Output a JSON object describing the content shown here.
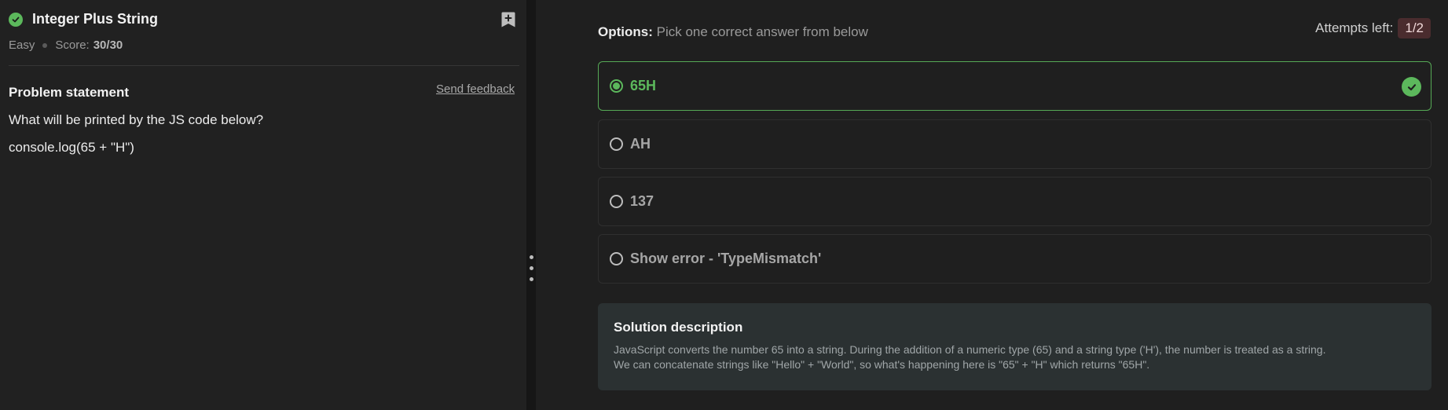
{
  "problem": {
    "title": "Integer Plus String",
    "difficulty": "Easy",
    "score_label": "Score:",
    "score_value": "30/30",
    "statement_label": "Problem statement",
    "feedback_link": "Send feedback",
    "question": "What will be printed by the JS code below?",
    "code": "console.log(65 + \"H\")"
  },
  "options_header": {
    "label": "Options:",
    "instruction": "Pick one correct answer from below"
  },
  "attempts": {
    "label": "Attempts left:",
    "value": "1/2"
  },
  "options": [
    {
      "label": "65H",
      "selected": true,
      "correct": true
    },
    {
      "label": "AH",
      "selected": false,
      "correct": false
    },
    {
      "label": "137",
      "selected": false,
      "correct": false
    },
    {
      "label": "Show error - 'TypeMismatch'",
      "selected": false,
      "correct": false
    }
  ],
  "solution": {
    "title": "Solution description",
    "line1": "JavaScript converts the number 65 into a string. During the addition of a numeric type (65) and a string type ('H'), the number is treated as a string.",
    "line2": "We can concatenate strings like \"Hello\" + \"World\", so what's happening here is \"65\" + \"H\" which returns \"65H\"."
  },
  "icons": {
    "solved": "check-circle-icon",
    "bookmark": "bookmark-add-icon",
    "correct": "check-circle-icon",
    "drag_handle": "vertical-dots-icon"
  },
  "colors": {
    "success": "#5cb85c",
    "attempts_badge": "#4a2c2e",
    "solution_bg": "#2b3132"
  }
}
